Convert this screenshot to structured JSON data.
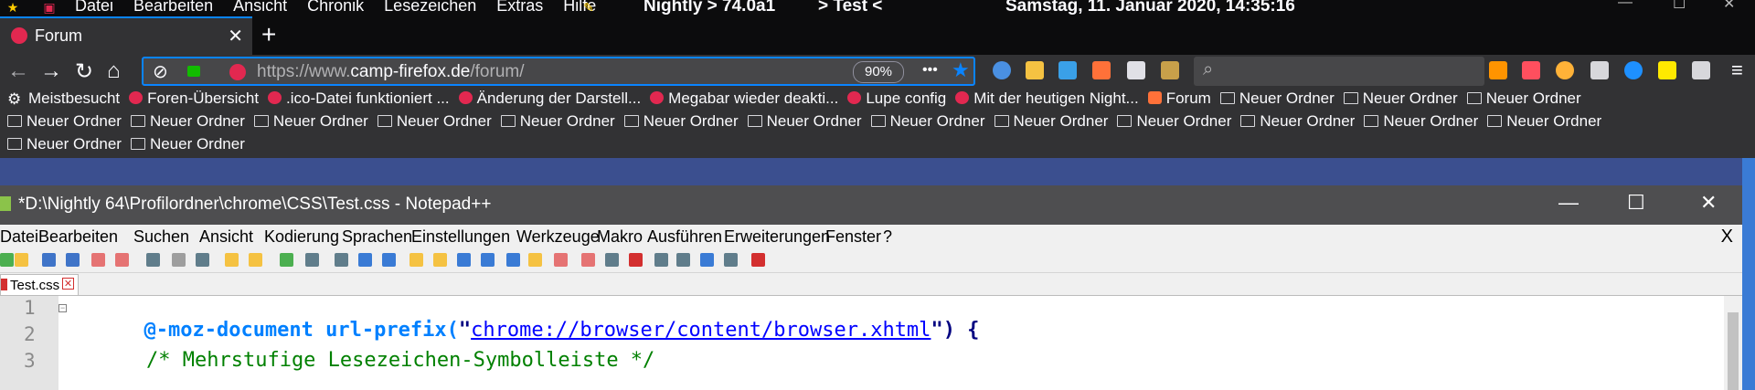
{
  "titlebar": {
    "menu": [
      "Datei",
      "Bearbeiten",
      "Ansicht",
      "Chronik",
      "Lesezeichen",
      "Extras",
      "Hilfe"
    ],
    "app_version": "Nightly   >  74.0a1",
    "profile": ">      Test   <",
    "datetime": "Samstag, 11. Januar 2020, 14:35:16"
  },
  "tab": {
    "title": "Forum",
    "close": "✕"
  },
  "new_tab": "+",
  "navbar": {
    "url_prefix": "https://www.",
    "url_domain": "camp-firefox.de",
    "url_path": "/forum/",
    "zoom": "90%",
    "more": "•••"
  },
  "bookmarks": {
    "row1": [
      "Meistbesucht",
      "Foren-Übersicht",
      ".ico-Datei funktioniert ...",
      "Änderung der Darstell...",
      "Megabar wieder deakti...",
      "Lupe config",
      "Mit der heutigen Night...",
      "Forum",
      "Neuer Ordner",
      "Neuer Ordner",
      "Neuer Ordner"
    ],
    "row2": [
      "Neuer Ordner",
      "Neuer Ordner",
      "Neuer Ordner",
      "Neuer Ordner",
      "Neuer Ordner",
      "Neuer Ordner",
      "Neuer Ordner",
      "Neuer Ordner",
      "Neuer Ordner",
      "Neuer Ordner",
      "Neuer Ordner",
      "Neuer Ordner",
      "Neuer Ordner"
    ],
    "row3": [
      "Neuer Ordner",
      "Neuer Ordner"
    ]
  },
  "notepad": {
    "title": "*D:\\Nightly 64\\Profilordner\\chrome\\CSS\\Test.css - Notepad++",
    "menu": [
      "Datei",
      "Bearbeiten",
      "Suchen",
      "Ansicht",
      "Kodierung",
      "Sprachen",
      "Einstellungen",
      "Werkzeuge",
      "Makro",
      "Ausführen",
      "Erweiterungen",
      "Fenster",
      "?"
    ],
    "menu_close": "X",
    "tab": "Test.css",
    "line_numbers": [
      "1",
      "2",
      "3"
    ],
    "code": {
      "l1_kw": "@-moz-document url-prefix(",
      "l1_q1": "\"",
      "l1_str": "chrome://browser/content/browser.xhtml",
      "l1_q2": "\"",
      "l1_end": ") {",
      "l3": "/* Mehrstufige Lesezeichen-Symbolleiste */"
    }
  },
  "colors": {
    "accent": "#0a84ff",
    "firefox_dark": "#323234",
    "npp_title": "#4e4e50"
  }
}
